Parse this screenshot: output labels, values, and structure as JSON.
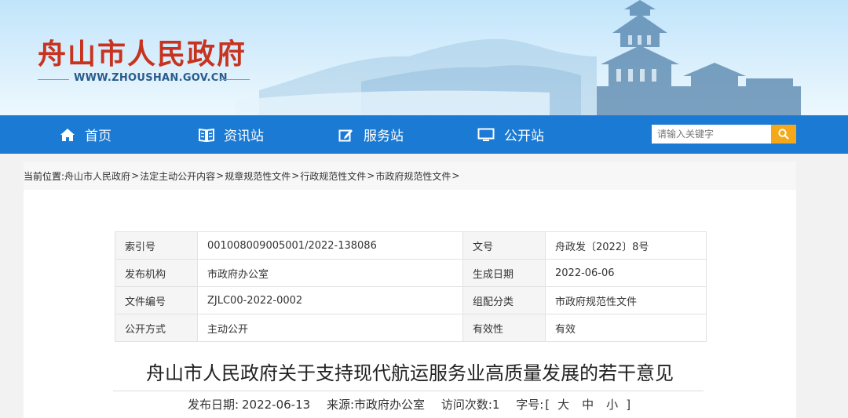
{
  "site": {
    "title": "舟山市人民政府",
    "url": "WWW.ZHOUSHAN.GOV.CN"
  },
  "nav": {
    "items": [
      {
        "label": "首页",
        "icon": "home-icon"
      },
      {
        "label": "资讯站",
        "icon": "book-icon"
      },
      {
        "label": "服务站",
        "icon": "edit-icon"
      },
      {
        "label": "公开站",
        "icon": "monitor-icon"
      }
    ],
    "search_placeholder": "请输入关键字"
  },
  "breadcrumb": {
    "prefix": "当前位置:",
    "items": [
      "舟山市人民政府",
      "法定主动公开内容",
      "规章规范性文件",
      "行政规范性文件",
      "市政府规范性文件"
    ],
    "separator": ">"
  },
  "meta": {
    "rows": [
      {
        "k1": "索引号",
        "v1": "001008009005001/2022-138086",
        "k2": "文号",
        "v2": "舟政发〔2022〕8号"
      },
      {
        "k1": "发布机构",
        "v1": "市政府办公室",
        "k2": "生成日期",
        "v2": "2022-06-06"
      },
      {
        "k1": "文件编号",
        "v1": "ZJLC00-2022-0002",
        "k2": "组配分类",
        "v2": "市政府规范性文件"
      },
      {
        "k1": "公开方式",
        "v1": "主动公开",
        "k2": "有效性",
        "v2": "有效"
      }
    ]
  },
  "document": {
    "title": "舟山市人民政府关于支持现代航运服务业高质量发展的若干意见",
    "publish_date_label": "发布日期:",
    "publish_date": "2022-06-13",
    "source_label": "来源:",
    "source": "市政府办公室",
    "visits_label": "访问次数:",
    "visits": "1",
    "fontsize_label": "字号:",
    "fontsize_open": "[",
    "fontsize_large": "大",
    "fontsize_medium": "中",
    "fontsize_small": "小",
    "fontsize_close": "]"
  },
  "colors": {
    "brand_red": "#c8331f",
    "nav_blue": "#1a7ad4",
    "search_orange": "#f4a81a"
  }
}
